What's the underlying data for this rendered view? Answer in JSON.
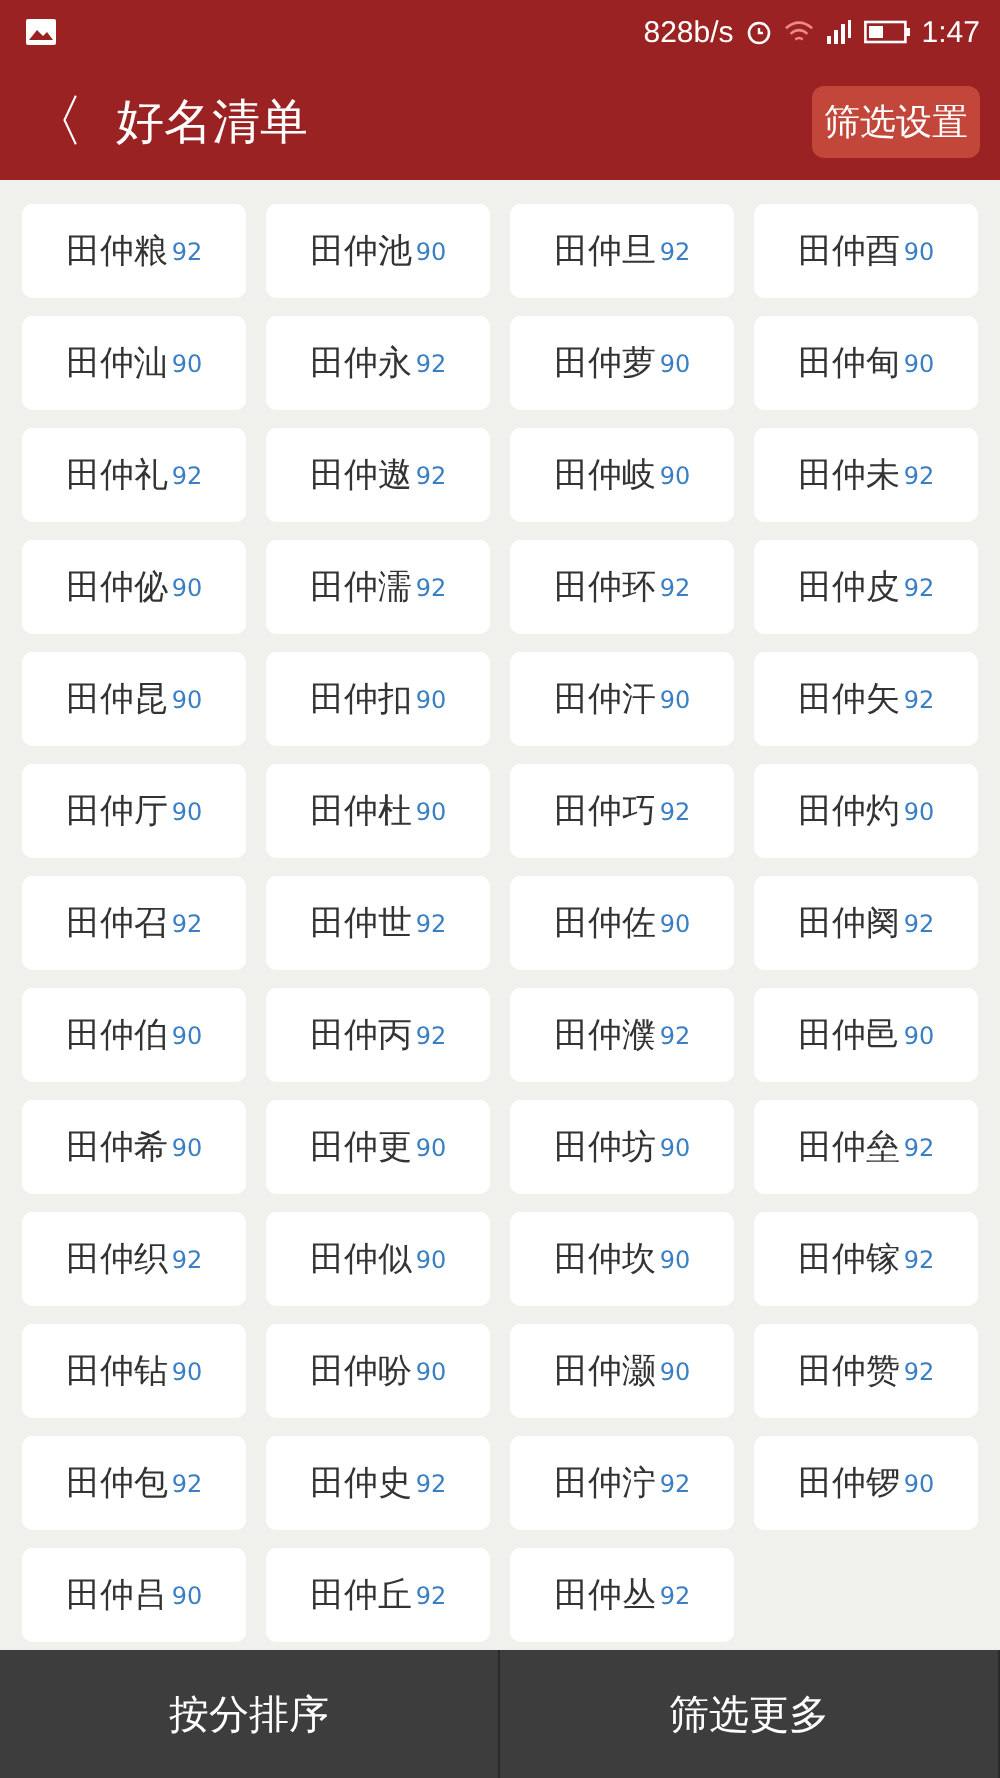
{
  "status_bar": {
    "speed": "828b/s",
    "time": "1:47"
  },
  "header": {
    "back": "〈",
    "title": "好名清单",
    "action": "筛选设置"
  },
  "names": [
    {
      "name": "田仲粮",
      "score": "92"
    },
    {
      "name": "田仲池",
      "score": "90"
    },
    {
      "name": "田仲旦",
      "score": "92"
    },
    {
      "name": "田仲酉",
      "score": "90"
    },
    {
      "name": "田仲汕",
      "score": "90"
    },
    {
      "name": "田仲永",
      "score": "92"
    },
    {
      "name": "田仲萝",
      "score": "90"
    },
    {
      "name": "田仲甸",
      "score": "90"
    },
    {
      "name": "田仲礼",
      "score": "92"
    },
    {
      "name": "田仲遨",
      "score": "92"
    },
    {
      "name": "田仲岐",
      "score": "90"
    },
    {
      "name": "田仲未",
      "score": "92"
    },
    {
      "name": "田仲佖",
      "score": "90"
    },
    {
      "name": "田仲濡",
      "score": "92"
    },
    {
      "name": "田仲环",
      "score": "92"
    },
    {
      "name": "田仲皮",
      "score": "92"
    },
    {
      "name": "田仲昆",
      "score": "90"
    },
    {
      "name": "田仲扣",
      "score": "90"
    },
    {
      "name": "田仲汗",
      "score": "90"
    },
    {
      "name": "田仲矢",
      "score": "92"
    },
    {
      "name": "田仲厅",
      "score": "90"
    },
    {
      "name": "田仲杜",
      "score": "90"
    },
    {
      "name": "田仲巧",
      "score": "92"
    },
    {
      "name": "田仲灼",
      "score": "90"
    },
    {
      "name": "田仲召",
      "score": "92"
    },
    {
      "name": "田仲世",
      "score": "92"
    },
    {
      "name": "田仲佐",
      "score": "90"
    },
    {
      "name": "田仲阕",
      "score": "92"
    },
    {
      "name": "田仲伯",
      "score": "90"
    },
    {
      "name": "田仲丙",
      "score": "92"
    },
    {
      "name": "田仲濮",
      "score": "92"
    },
    {
      "name": "田仲邑",
      "score": "90"
    },
    {
      "name": "田仲希",
      "score": "90"
    },
    {
      "name": "田仲更",
      "score": "90"
    },
    {
      "name": "田仲坊",
      "score": "90"
    },
    {
      "name": "田仲垒",
      "score": "92"
    },
    {
      "name": "田仲织",
      "score": "92"
    },
    {
      "name": "田仲似",
      "score": "90"
    },
    {
      "name": "田仲坎",
      "score": "90"
    },
    {
      "name": "田仲镓",
      "score": "92"
    },
    {
      "name": "田仲钻",
      "score": "90"
    },
    {
      "name": "田仲吩",
      "score": "90"
    },
    {
      "name": "田仲灏",
      "score": "90"
    },
    {
      "name": "田仲赞",
      "score": "92"
    },
    {
      "name": "田仲包",
      "score": "92"
    },
    {
      "name": "田仲史",
      "score": "92"
    },
    {
      "name": "田仲泞",
      "score": "92"
    },
    {
      "name": "田仲锣",
      "score": "90"
    },
    {
      "name": "田仲吕",
      "score": "90"
    },
    {
      "name": "田仲丘",
      "score": "92"
    },
    {
      "name": "田仲丛",
      "score": "92"
    }
  ],
  "bottom_bar": [
    "按分排序",
    "筛选更多"
  ]
}
